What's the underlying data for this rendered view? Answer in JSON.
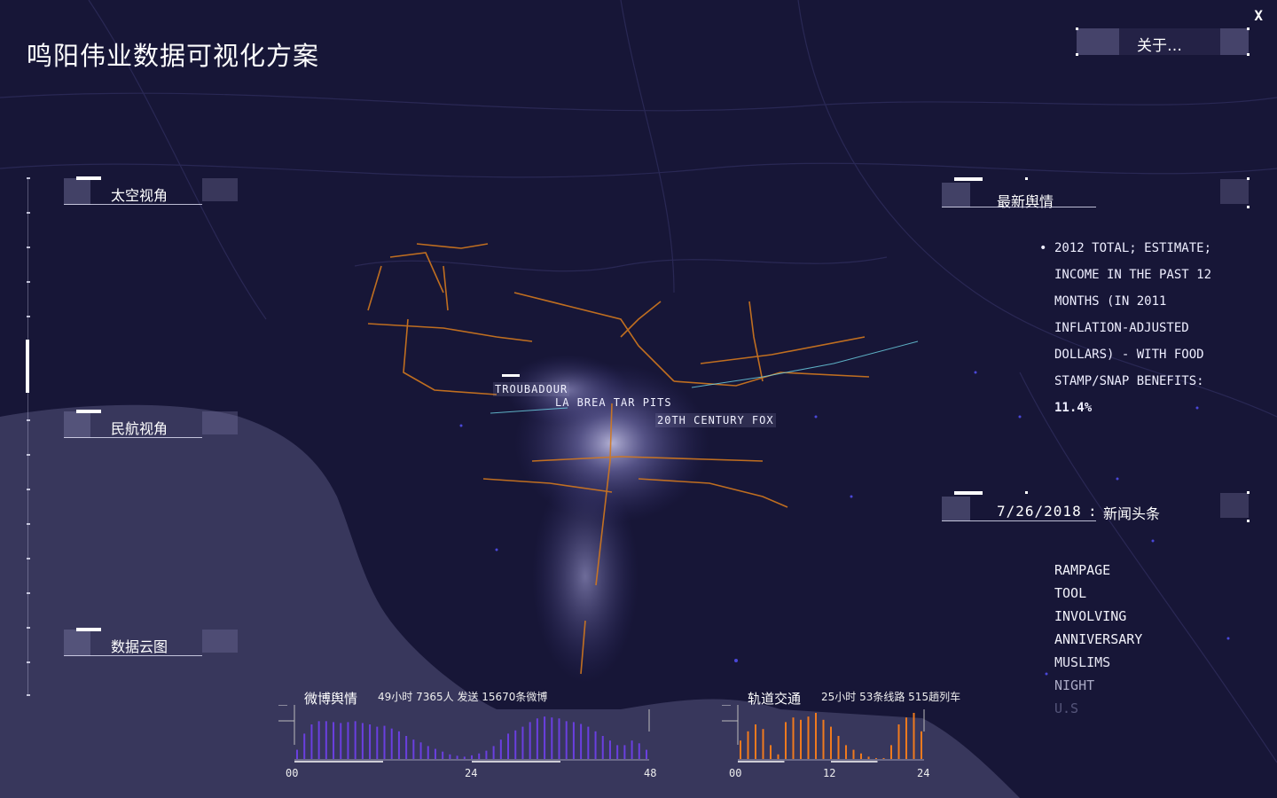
{
  "header": {
    "title": "鸣阳伟业数据可视化方案",
    "close_label": "X",
    "about_label": "关于…"
  },
  "sidebar": {
    "items": [
      {
        "label": "太空视角",
        "active": true
      },
      {
        "label": "民航视角",
        "active": false
      },
      {
        "label": "数据云图",
        "active": false
      }
    ]
  },
  "map_labels": [
    {
      "name": "troubadour",
      "text": "TROUBADOUR"
    },
    {
      "name": "la-brea-tar-pits",
      "text": "LA BREA TAR PITS"
    },
    {
      "name": "20th-century-fox",
      "text": "20TH CENTURY FOX"
    }
  ],
  "sentiment_panel": {
    "title": "最新舆情",
    "lines": [
      "2012 TOTAL; ESTIMATE;",
      "INCOME IN THE PAST 12",
      "MONTHS (IN 2011",
      "INFLATION-ADJUSTED",
      "DOLLARS) - WITH FOOD",
      "STAMP/SNAP BENEFITS:"
    ],
    "value": "11.4%"
  },
  "news_panel": {
    "date": "7/26/2018",
    "separator": ":",
    "title": "新闻头条",
    "keywords": [
      "RAMPAGE",
      "TOOL",
      "INVOLVING",
      "ANNIVERSARY",
      "MUSLIMS",
      "NIGHT",
      "U.S"
    ]
  },
  "colors": {
    "background": "#171637",
    "weibo_bars": "#6a3fe0",
    "transit_bars": "#f07a1e",
    "text": "#ffffff"
  },
  "chart_data": [
    {
      "type": "bar",
      "title": "微博舆情",
      "stats": "49小时 7365人 发送 15670条微博",
      "x_ticks": [
        "00",
        "24",
        "48"
      ],
      "xlim": [
        0,
        48
      ],
      "values": [
        0.2,
        0.55,
        0.75,
        0.82,
        0.82,
        0.8,
        0.78,
        0.8,
        0.82,
        0.78,
        0.75,
        0.7,
        0.72,
        0.66,
        0.6,
        0.5,
        0.42,
        0.36,
        0.28,
        0.22,
        0.16,
        0.1,
        0.07,
        0.05,
        0.08,
        0.12,
        0.18,
        0.28,
        0.42,
        0.55,
        0.62,
        0.7,
        0.8,
        0.88,
        0.92,
        0.9,
        0.88,
        0.82,
        0.8,
        0.76,
        0.7,
        0.6,
        0.5,
        0.4,
        0.3,
        0.3,
        0.4,
        0.34,
        0.2
      ]
    },
    {
      "type": "bar",
      "title": "轨道交通",
      "stats": "25小时 53条线路 515趟列车",
      "x_ticks": [
        "00",
        "12",
        "24"
      ],
      "xlim": [
        0,
        24
      ],
      "values": [
        0.4,
        0.6,
        0.75,
        0.65,
        0.3,
        0.1,
        0.8,
        0.9,
        0.85,
        0.92,
        1.0,
        0.85,
        0.7,
        0.5,
        0.3,
        0.2,
        0.12,
        0.05,
        0.02,
        0.02,
        0.3,
        0.75,
        0.9,
        1.0,
        0.6
      ]
    }
  ]
}
